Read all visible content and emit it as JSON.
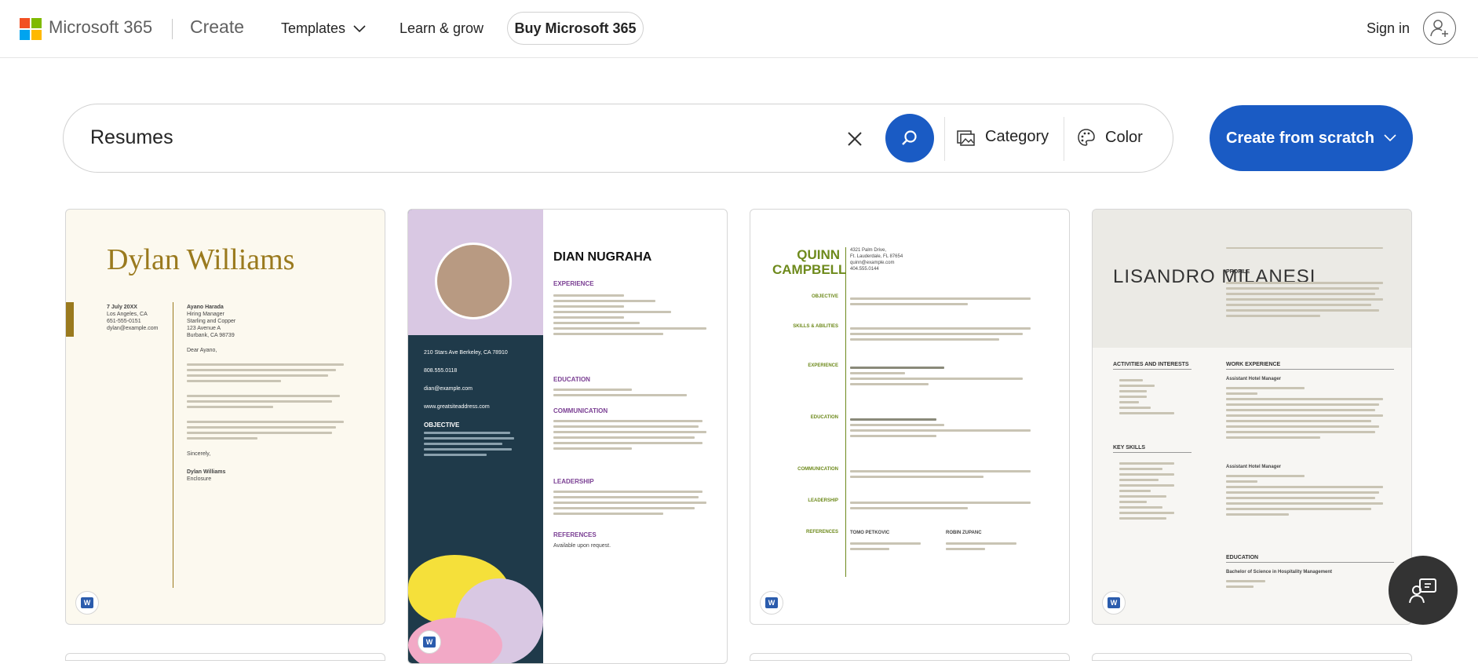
{
  "header": {
    "brand": "Microsoft 365",
    "create": "Create",
    "nav": [
      "Templates",
      "Learn & grow"
    ],
    "buy": "Buy Microsoft 365",
    "sign_in": "Sign in",
    "logo_colors": [
      "#f25022",
      "#7fba00",
      "#00a4ef",
      "#ffb900"
    ]
  },
  "search": {
    "value": "Resumes",
    "category": "Category",
    "color": "Color"
  },
  "cta": "Create from scratch",
  "cards": {
    "c1": {
      "name": "Dylan Williams",
      "date": "7 July 20XX",
      "contact": [
        "Los Angeles, CA",
        "651-555-0151",
        "dylan@example.com"
      ],
      "recipient": [
        "Ayano Harada",
        "Hiring Manager",
        "Starling and Copper",
        "123 Avenue A",
        "Burbank, CA 98739"
      ],
      "salutation": "Dear Ayano,",
      "closing": "Sincerely,",
      "signature": "Dylan Williams",
      "enclosure": "Enclosure"
    },
    "c2": {
      "name": "DIAN NUGRAHA",
      "sections": [
        "EXPERIENCE",
        "EDUCATION",
        "COMMUNICATION",
        "LEADERSHIP",
        "REFERENCES"
      ],
      "contact": [
        "210 Stars Ave Berkeley, CA 78910",
        "808.555.0118",
        "dian@example.com",
        "www.greatsiteaddress.com"
      ],
      "objective": "OBJECTIVE",
      "references": "Available upon request."
    },
    "c3": {
      "name": "QUINN CAMPBELL",
      "contact": [
        "4321 Palm Drive,",
        "Ft. Lauderdale, FL 87654",
        "quinn@example.com",
        "404.555.0144"
      ],
      "labels": [
        "OBJECTIVE",
        "SKILLS & ABILITIES",
        "EXPERIENCE",
        "EDUCATION",
        "COMMUNICATION",
        "LEADERSHIP",
        "REFERENCES"
      ],
      "refs": [
        "TOMO PETKOVIC",
        "ROBIN ZUPANC"
      ]
    },
    "c4": {
      "name": "LISANDRO MILANESI",
      "headers": [
        "PROFILE",
        "ACTIVITIES AND INTERESTS",
        "WORK EXPERIENCE",
        "KEY SKILLS",
        "EDUCATION"
      ],
      "role": "Assistant Hotel Manager",
      "degree": "Bachelor of Science in Hospitality Management"
    }
  }
}
